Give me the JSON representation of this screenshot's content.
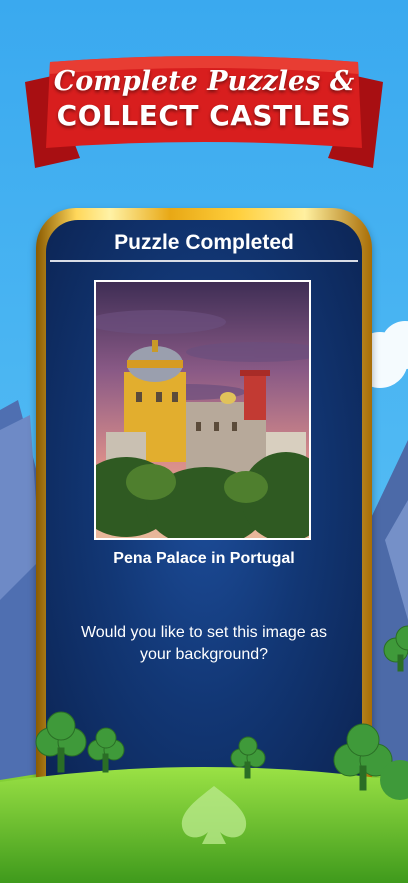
{
  "banner": {
    "line1": "Complete Puzzles &",
    "line2": "COLLECT CASTLES"
  },
  "dialog": {
    "title": "Puzzle Completed",
    "caption": "Pena Palace in Portugal",
    "question": "Would you like to set this image as your background?"
  },
  "colors": {
    "sky": "#3aa9ef",
    "ribbon": "#d81e1e",
    "panel": "#123775",
    "frame_gold": "#e8a815",
    "grass": "#5dbb2a"
  },
  "icons": {
    "club_trees": "club-shaped-tree",
    "spade_emblem": "spade-icon"
  }
}
